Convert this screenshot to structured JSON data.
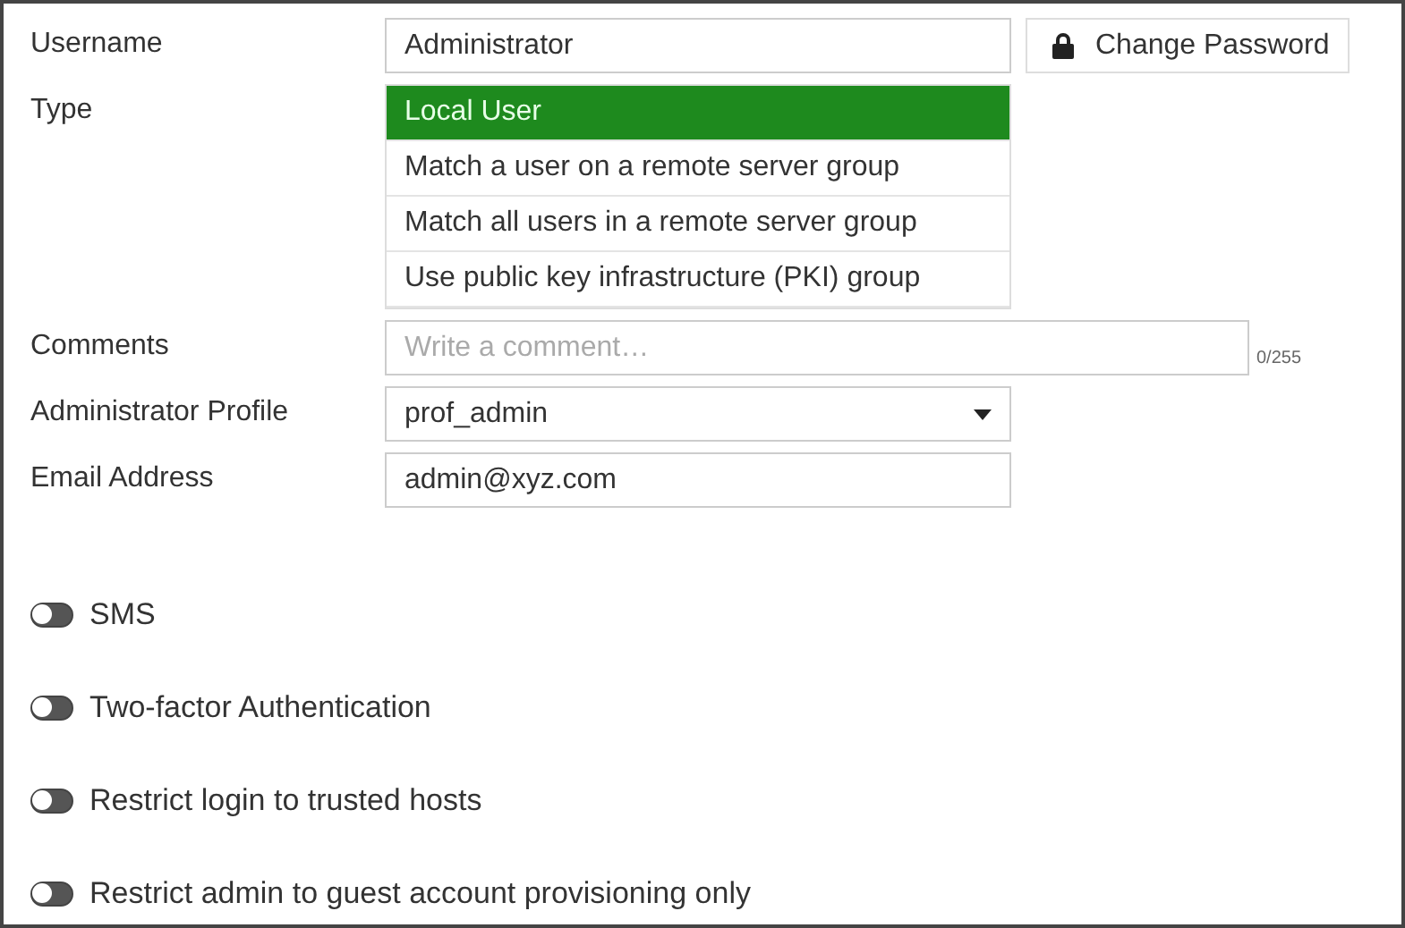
{
  "username": {
    "label": "Username",
    "value": "Administrator"
  },
  "change_password_button": {
    "label": "Change Password"
  },
  "type": {
    "label": "Type",
    "options": [
      {
        "label": "Local User",
        "selected": true
      },
      {
        "label": "Match a user on a remote server group",
        "selected": false
      },
      {
        "label": "Match all users in a remote server group",
        "selected": false
      },
      {
        "label": "Use public key infrastructure (PKI) group",
        "selected": false
      }
    ]
  },
  "comments": {
    "label": "Comments",
    "placeholder": "Write a comment…",
    "counter": "0/255"
  },
  "administrator_profile": {
    "label": "Administrator Profile",
    "value": "prof_admin"
  },
  "email_address": {
    "label": "Email Address",
    "value": "admin@xyz.com"
  },
  "toggles": [
    {
      "label": "SMS",
      "on": false
    },
    {
      "label": "Two-factor Authentication",
      "on": false
    },
    {
      "label": "Restrict login to trusted hosts",
      "on": false
    },
    {
      "label": "Restrict admin to guest account provisioning only",
      "on": false
    }
  ]
}
